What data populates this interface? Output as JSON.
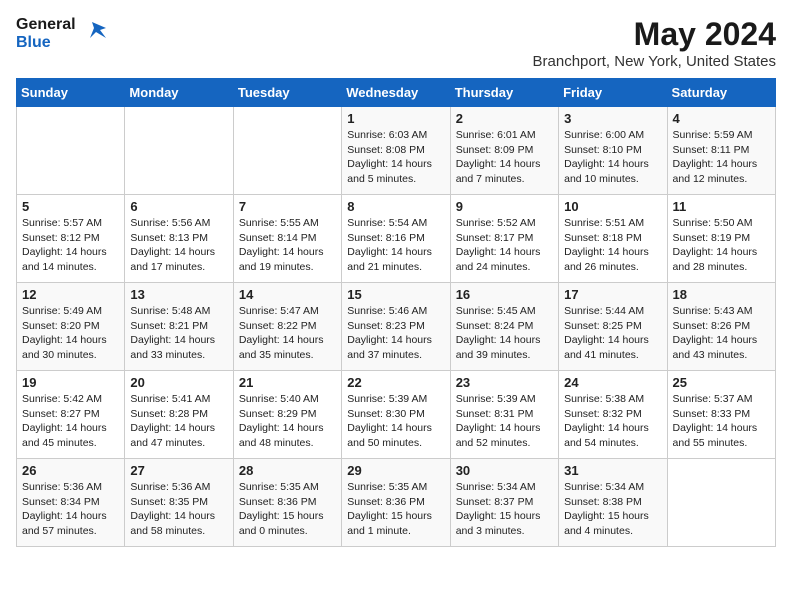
{
  "header": {
    "logo_line1": "General",
    "logo_line2": "Blue",
    "title": "May 2024",
    "subtitle": "Branchport, New York, United States"
  },
  "days_of_week": [
    "Sunday",
    "Monday",
    "Tuesday",
    "Wednesday",
    "Thursday",
    "Friday",
    "Saturday"
  ],
  "weeks": [
    [
      {
        "day": "",
        "content": ""
      },
      {
        "day": "",
        "content": ""
      },
      {
        "day": "",
        "content": ""
      },
      {
        "day": "1",
        "content": "Sunrise: 6:03 AM\nSunset: 8:08 PM\nDaylight: 14 hours\nand 5 minutes."
      },
      {
        "day": "2",
        "content": "Sunrise: 6:01 AM\nSunset: 8:09 PM\nDaylight: 14 hours\nand 7 minutes."
      },
      {
        "day": "3",
        "content": "Sunrise: 6:00 AM\nSunset: 8:10 PM\nDaylight: 14 hours\nand 10 minutes."
      },
      {
        "day": "4",
        "content": "Sunrise: 5:59 AM\nSunset: 8:11 PM\nDaylight: 14 hours\nand 12 minutes."
      }
    ],
    [
      {
        "day": "5",
        "content": "Sunrise: 5:57 AM\nSunset: 8:12 PM\nDaylight: 14 hours\nand 14 minutes."
      },
      {
        "day": "6",
        "content": "Sunrise: 5:56 AM\nSunset: 8:13 PM\nDaylight: 14 hours\nand 17 minutes."
      },
      {
        "day": "7",
        "content": "Sunrise: 5:55 AM\nSunset: 8:14 PM\nDaylight: 14 hours\nand 19 minutes."
      },
      {
        "day": "8",
        "content": "Sunrise: 5:54 AM\nSunset: 8:16 PM\nDaylight: 14 hours\nand 21 minutes."
      },
      {
        "day": "9",
        "content": "Sunrise: 5:52 AM\nSunset: 8:17 PM\nDaylight: 14 hours\nand 24 minutes."
      },
      {
        "day": "10",
        "content": "Sunrise: 5:51 AM\nSunset: 8:18 PM\nDaylight: 14 hours\nand 26 minutes."
      },
      {
        "day": "11",
        "content": "Sunrise: 5:50 AM\nSunset: 8:19 PM\nDaylight: 14 hours\nand 28 minutes."
      }
    ],
    [
      {
        "day": "12",
        "content": "Sunrise: 5:49 AM\nSunset: 8:20 PM\nDaylight: 14 hours\nand 30 minutes."
      },
      {
        "day": "13",
        "content": "Sunrise: 5:48 AM\nSunset: 8:21 PM\nDaylight: 14 hours\nand 33 minutes."
      },
      {
        "day": "14",
        "content": "Sunrise: 5:47 AM\nSunset: 8:22 PM\nDaylight: 14 hours\nand 35 minutes."
      },
      {
        "day": "15",
        "content": "Sunrise: 5:46 AM\nSunset: 8:23 PM\nDaylight: 14 hours\nand 37 minutes."
      },
      {
        "day": "16",
        "content": "Sunrise: 5:45 AM\nSunset: 8:24 PM\nDaylight: 14 hours\nand 39 minutes."
      },
      {
        "day": "17",
        "content": "Sunrise: 5:44 AM\nSunset: 8:25 PM\nDaylight: 14 hours\nand 41 minutes."
      },
      {
        "day": "18",
        "content": "Sunrise: 5:43 AM\nSunset: 8:26 PM\nDaylight: 14 hours\nand 43 minutes."
      }
    ],
    [
      {
        "day": "19",
        "content": "Sunrise: 5:42 AM\nSunset: 8:27 PM\nDaylight: 14 hours\nand 45 minutes."
      },
      {
        "day": "20",
        "content": "Sunrise: 5:41 AM\nSunset: 8:28 PM\nDaylight: 14 hours\nand 47 minutes."
      },
      {
        "day": "21",
        "content": "Sunrise: 5:40 AM\nSunset: 8:29 PM\nDaylight: 14 hours\nand 48 minutes."
      },
      {
        "day": "22",
        "content": "Sunrise: 5:39 AM\nSunset: 8:30 PM\nDaylight: 14 hours\nand 50 minutes."
      },
      {
        "day": "23",
        "content": "Sunrise: 5:39 AM\nSunset: 8:31 PM\nDaylight: 14 hours\nand 52 minutes."
      },
      {
        "day": "24",
        "content": "Sunrise: 5:38 AM\nSunset: 8:32 PM\nDaylight: 14 hours\nand 54 minutes."
      },
      {
        "day": "25",
        "content": "Sunrise: 5:37 AM\nSunset: 8:33 PM\nDaylight: 14 hours\nand 55 minutes."
      }
    ],
    [
      {
        "day": "26",
        "content": "Sunrise: 5:36 AM\nSunset: 8:34 PM\nDaylight: 14 hours\nand 57 minutes."
      },
      {
        "day": "27",
        "content": "Sunrise: 5:36 AM\nSunset: 8:35 PM\nDaylight: 14 hours\nand 58 minutes."
      },
      {
        "day": "28",
        "content": "Sunrise: 5:35 AM\nSunset: 8:36 PM\nDaylight: 15 hours\nand 0 minutes."
      },
      {
        "day": "29",
        "content": "Sunrise: 5:35 AM\nSunset: 8:36 PM\nDaylight: 15 hours\nand 1 minute."
      },
      {
        "day": "30",
        "content": "Sunrise: 5:34 AM\nSunset: 8:37 PM\nDaylight: 15 hours\nand 3 minutes."
      },
      {
        "day": "31",
        "content": "Sunrise: 5:34 AM\nSunset: 8:38 PM\nDaylight: 15 hours\nand 4 minutes."
      },
      {
        "day": "",
        "content": ""
      }
    ]
  ]
}
